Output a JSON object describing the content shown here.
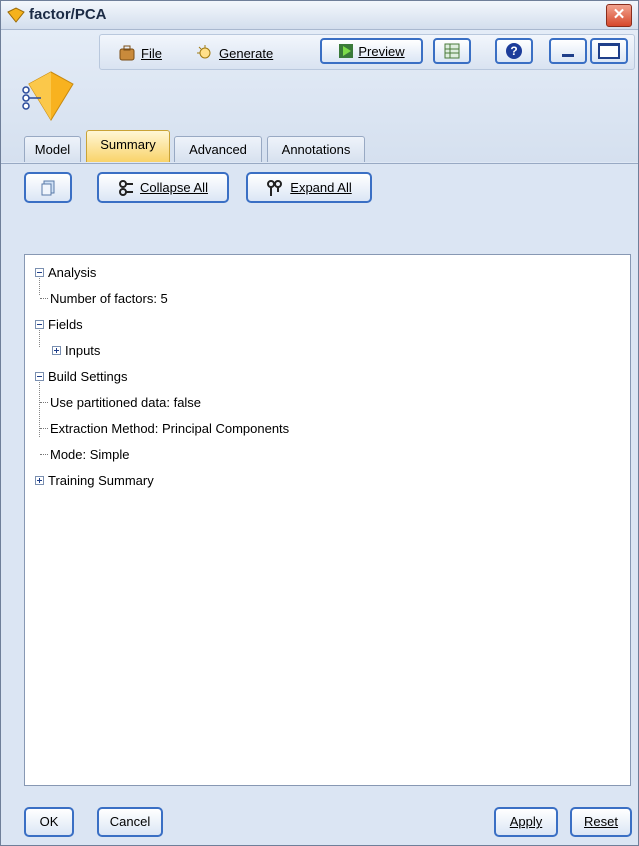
{
  "window": {
    "title": "factor/PCA",
    "close_glyph": "✕"
  },
  "toolbar": {
    "file_label": "File",
    "generate_label": "Generate",
    "preview_label": "Preview",
    "help_glyph": "?"
  },
  "tabs": [
    {
      "label": "Model"
    },
    {
      "label": "Summary",
      "active": true
    },
    {
      "label": "Advanced"
    },
    {
      "label": "Annotations"
    }
  ],
  "panel_toolbar": {
    "collapse_label": "Collapse All",
    "expand_label": "Expand All"
  },
  "tree": {
    "analysis": "Analysis",
    "number_of_factors": "Number of factors: 5",
    "fields": "Fields",
    "inputs": "Inputs",
    "build_settings": "Build Settings",
    "use_partitioned": "Use partitioned data: false",
    "extraction_method": "Extraction Method: Principal Components",
    "mode": "Mode: Simple",
    "training_summary": "Training Summary"
  },
  "buttons": {
    "ok": "OK",
    "cancel": "Cancel",
    "apply": "Apply",
    "reset": "Reset"
  },
  "icons": [
    "node-diamond-icon",
    "file-icon",
    "generate-icon",
    "preview-icon",
    "export-icon",
    "help-icon",
    "minimize-icon",
    "maximize-icon",
    "copy-icon",
    "collapse-icon",
    "expand-icon"
  ],
  "colors": {
    "active_tab": "#f9d36a",
    "button_border": "#3a6fc4",
    "panel_bg": "#dbe5f3"
  }
}
